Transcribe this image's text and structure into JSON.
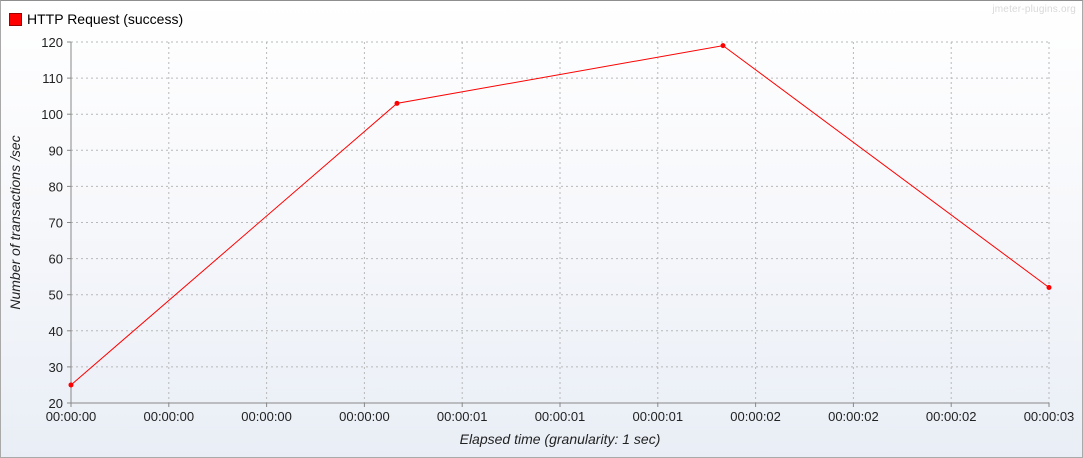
{
  "chart_data": {
    "type": "line",
    "legend": "HTTP Request (success)",
    "watermark": "jmeter-plugins.org",
    "xlabel": "Elapsed time (granularity: 1 sec)",
    "ylabel": "Number of transactions /sec",
    "ylim": [
      20,
      120
    ],
    "yticks": [
      20,
      30,
      40,
      50,
      60,
      70,
      80,
      90,
      100,
      110,
      120
    ],
    "xlim": [
      0,
      3
    ],
    "xticks": [
      0,
      0.3,
      0.6,
      0.9,
      1.2,
      1.5,
      1.8,
      2.1,
      2.4,
      2.7,
      3.0
    ],
    "xtick_labels": [
      "00:00:00",
      "00:00:00",
      "00:00:00",
      "00:00:00",
      "00:00:01",
      "00:00:01",
      "00:00:01",
      "00:00:02",
      "00:00:02",
      "00:00:02",
      "00:00:03"
    ],
    "grid": true,
    "legend_position": "top-left",
    "series": [
      {
        "name": "HTTP Request (success)",
        "color": "#ff0000",
        "x": [
          0,
          1,
          2,
          3
        ],
        "y": [
          25,
          103,
          119,
          52
        ]
      }
    ]
  }
}
